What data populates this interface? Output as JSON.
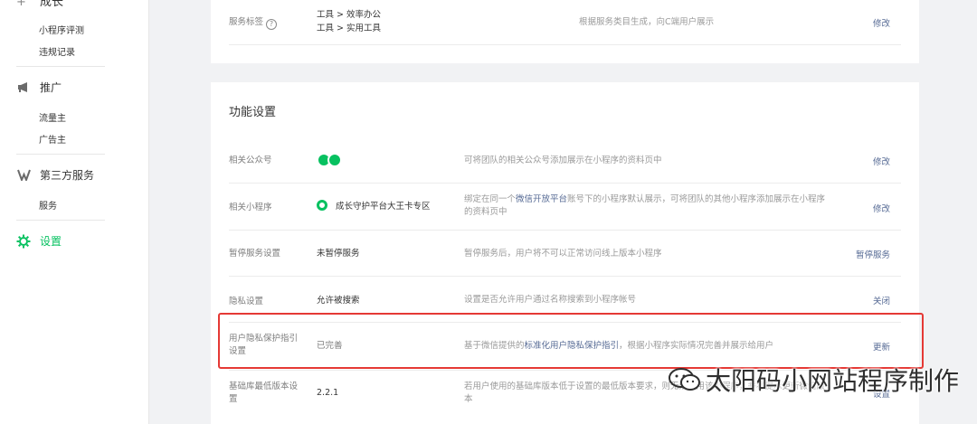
{
  "sidebar": {
    "partial_group": "成长",
    "growth_items": [
      "小程序评测",
      "违规记录"
    ],
    "promo": {
      "label": "推广",
      "items": [
        "流量主",
        "广告主"
      ]
    },
    "third_party": {
      "label": "第三方服务",
      "items": [
        "服务"
      ]
    },
    "settings": {
      "label": "设置"
    }
  },
  "top_card": {
    "label": "服务标签",
    "values": [
      "工具 > 效率办公",
      "工具 > 实用工具"
    ],
    "desc": "根据服务类目生成，向C端用户展示",
    "action": "修改"
  },
  "section": {
    "title": "功能设置",
    "rows": [
      {
        "label": "相关公众号",
        "desc": "可将团队的相关公众号添加展示在小程序的资料页中",
        "action": "修改"
      },
      {
        "label": "相关小程序",
        "value": "成长守护平台大王卡专区",
        "desc_a": "绑定在同一个",
        "desc_link": "微信开放平台",
        "desc_b": "账号下的小程序默认展示，可将团队的其他小程序添加展示在小程序的资料页中",
        "action": "修改"
      },
      {
        "label": "暂停服务设置",
        "value": "未暂停服务",
        "desc": "暂停服务后，用户将不可以正常访问线上版本小程序",
        "action": "暂停服务"
      },
      {
        "label": "隐私设置",
        "value": "允许被搜索",
        "desc": "设置是否允许用户通过名称搜索到小程序帐号",
        "action": "关闭"
      },
      {
        "label": "用户隐私保护指引设置",
        "value": "已完善",
        "desc_a": "基于微信提供的",
        "desc_link": "标准化用户隐私保护指引",
        "desc_b": "，根据小程序实际情况完善并展示给用户",
        "action": "更新"
      },
      {
        "label": "基础库最低版本设置",
        "value": "2.2.1",
        "desc": "若用户使用的基础库版本低于设置的最低版本要求，则无法使用该小程序，并将提示更新微信版本",
        "action": "设置"
      }
    ]
  },
  "watermark": "太阳码小网站程序制作",
  "colors": {
    "accent": "#07c160",
    "link": "#576b95",
    "highlight": "#e53935"
  }
}
